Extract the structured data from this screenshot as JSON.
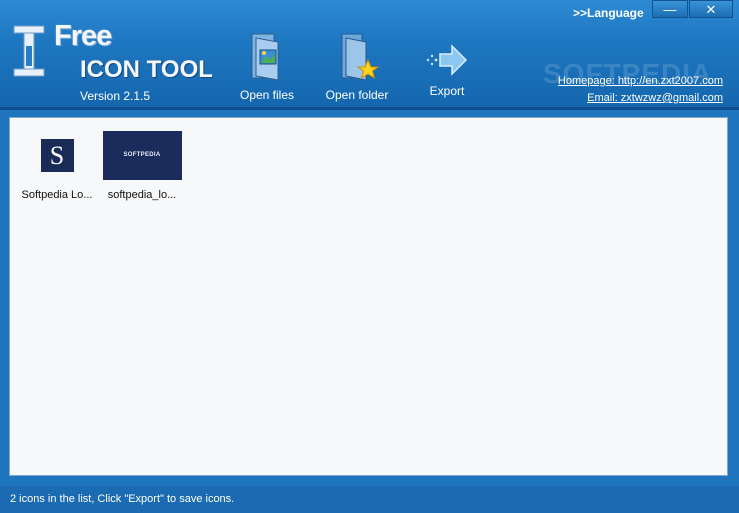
{
  "app": {
    "logo_free": "Free",
    "logo_tool": "ICON TOOL",
    "version": "Version 2.1.5",
    "watermark": "SOFTPEDIA"
  },
  "window_controls": {
    "language": ">>Language",
    "minimize": "—",
    "close": "✕"
  },
  "toolbar": {
    "open_files": "Open files",
    "open_folder": "Open folder",
    "export": "Export"
  },
  "links": {
    "homepage": "Homepage: http://en.zxt2007.com",
    "email": "Email: zxtwzwz@gmail.com"
  },
  "icons": [
    {
      "name": "Softpedia Lo...",
      "thumb_text": "S"
    },
    {
      "name": "softpedia_lo...",
      "thumb_text": "SOFTPEDIA"
    }
  ],
  "status": {
    "text": "2 icons in the list, Click \"Export\" to save icons."
  },
  "colors": {
    "header": "#1f78c2",
    "statusbar": "#1a6bb1",
    "list_bg": "#f7f8f9",
    "thumb_bg": "#1a2b57"
  }
}
